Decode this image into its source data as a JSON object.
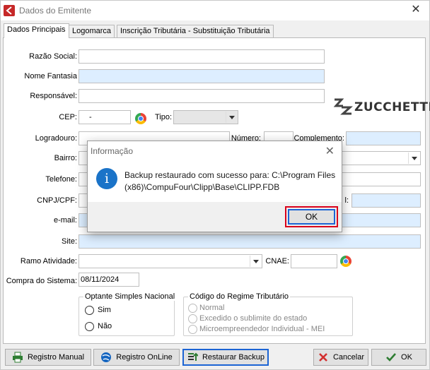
{
  "window": {
    "title": "Dados do Emitente"
  },
  "tabs": [
    {
      "label": "Dados Principais"
    },
    {
      "label": "Logomarca"
    },
    {
      "label": "Inscrição Tributária - Substituição Tributária"
    }
  ],
  "logo": {
    "text": "ZUCCHETTI"
  },
  "fields": {
    "razao_social": {
      "label": "Razão Social:",
      "value": ""
    },
    "nome_fantasia": {
      "label": "Nome Fantasia",
      "value": ""
    },
    "responsavel": {
      "label": "Responsável:",
      "value": ""
    },
    "cep": {
      "label": "CEP:",
      "value": "-"
    },
    "tipo": {
      "label": "Tipo:",
      "value": ""
    },
    "logradouro": {
      "label": "Logradouro:",
      "value": ""
    },
    "numero": {
      "label": "Número:",
      "value": ""
    },
    "complemento": {
      "label": "Complemento:",
      "value": ""
    },
    "bairro": {
      "label": "Bairro:",
      "value": ""
    },
    "telefone": {
      "label": "Telefone:",
      "value": ""
    },
    "cnpj_cpf": {
      "label": "CNPJ/CPF:",
      "value": ""
    },
    "partial_label": {
      "label": "l:"
    },
    "email": {
      "label": "e-mail:",
      "value": ""
    },
    "site": {
      "label": "Site:",
      "value": ""
    },
    "ramo_atividade": {
      "label": "Ramo Atividade:",
      "value": ""
    },
    "cnae": {
      "label": "CNAE:",
      "value": ""
    },
    "compra_sistema": {
      "label": "Compra do Sistema:",
      "value": "08/11/2024"
    }
  },
  "simples": {
    "title": "Optante Simples Nacional",
    "options": [
      "Sim",
      "Não"
    ]
  },
  "regime": {
    "title": "Código do Regime Tributário",
    "options": [
      "Normal",
      "Excedido o sublimite do estado",
      "Microempreendedor Individual - MEI"
    ]
  },
  "buttons": {
    "registro_manual": "Registro Manual",
    "registro_online": "Registro OnLine",
    "restaurar_backup": "Restaurar Backup",
    "cancelar": "Cancelar",
    "ok": "OK"
  },
  "dialog": {
    "title": "Informação",
    "message": "Backup restaurado com sucesso para: C:\\Program Files (x86)\\CompuFour\\Clipp\\Base\\CLIPP.FDB",
    "ok": "OK"
  },
  "colors": {
    "brand": "#c62828",
    "field_highlight": "#ddeeff",
    "focus_border": "#1c64d4",
    "annotation": "#d9001b"
  }
}
